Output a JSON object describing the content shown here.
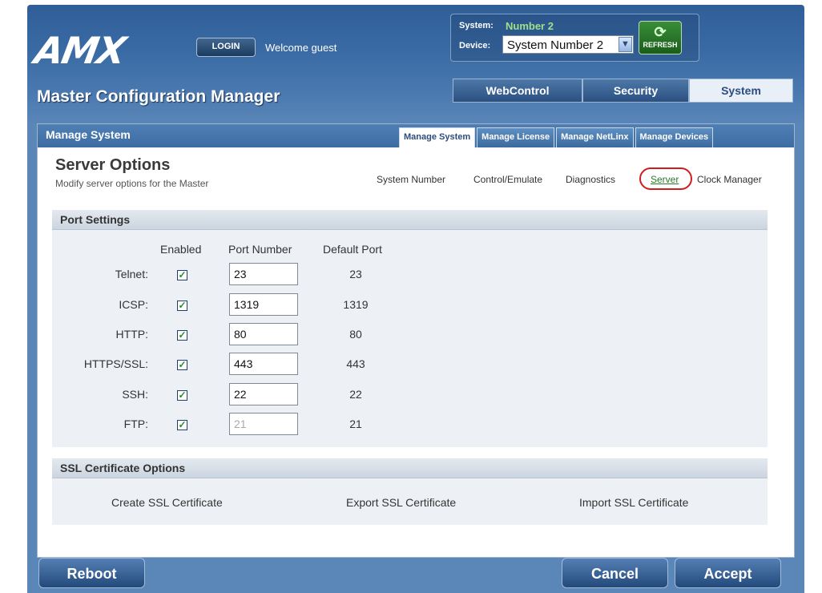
{
  "header": {
    "logo_text": "AMX",
    "login_label": "LOGIN",
    "welcome_text": "Welcome guest",
    "system_label": "System:",
    "system_value": "Number 2",
    "device_label": "Device:",
    "device_value": "System Number 2",
    "refresh_label": "REFRESH",
    "app_title": "Master Configuration Manager"
  },
  "main_tabs": [
    {
      "label": "WebControl"
    },
    {
      "label": "Security"
    },
    {
      "label": "System",
      "active": true
    }
  ],
  "panel": {
    "title": "Manage System",
    "sub_tabs": [
      {
        "label": "Manage System",
        "active": true
      },
      {
        "label": "Manage License"
      },
      {
        "label": "Manage NetLinx"
      },
      {
        "label": "Manage Devices"
      }
    ]
  },
  "page": {
    "title": "Server Options",
    "description": "Modify server options for the Master",
    "sub_nav": [
      "System Number",
      "Control/Emulate",
      "Diagnostics",
      "Server",
      "Clock Manager"
    ],
    "selected_sub_nav": "Server"
  },
  "port_settings": {
    "title": "Port Settings",
    "columns": [
      "Enabled",
      "Port Number",
      "Default Port"
    ],
    "rows": [
      {
        "label": "Telnet:",
        "enabled": true,
        "port": "23",
        "default": "23"
      },
      {
        "label": "ICSP:",
        "enabled": true,
        "port": "1319",
        "default": "1319"
      },
      {
        "label": "HTTP:",
        "enabled": true,
        "port": "80",
        "default": "80"
      },
      {
        "label": "HTTPS/SSL:",
        "enabled": true,
        "port": "443",
        "default": "443"
      },
      {
        "label": "SSH:",
        "enabled": true,
        "port": "22",
        "default": "22"
      },
      {
        "label": "FTP:",
        "enabled": true,
        "port": "21",
        "default": "21",
        "port_disabled": true
      }
    ]
  },
  "ssl": {
    "title": "SSL Certificate Options",
    "links": [
      "Create SSL Certificate",
      "Export SSL Certificate",
      "Import SSL Certificate"
    ]
  },
  "footer": {
    "reboot_label": "Reboot",
    "cancel_label": "Cancel",
    "accept_label": "Accept"
  },
  "colors": {
    "header_blue": "#3b6ba4",
    "accent_green": "#9fe08a",
    "highlight_red": "#d11c1c",
    "check_green": "#2b8a2b"
  },
  "icons": {
    "refresh": "refresh-icon",
    "dropdown": "chevron-down-icon",
    "checkbox": "checkmark-icon"
  }
}
